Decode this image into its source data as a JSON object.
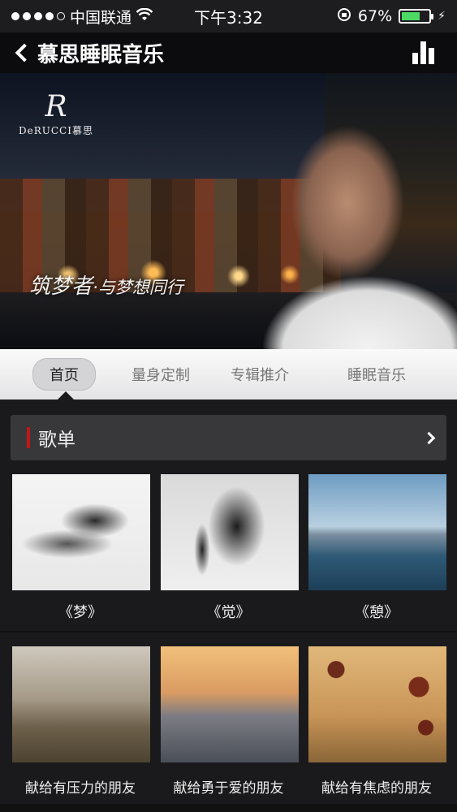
{
  "status_bar": {
    "carrier": "中国联通",
    "time": "下午3:32",
    "battery": "67%"
  },
  "nav": {
    "title": "慕思睡眠音乐"
  },
  "banner": {
    "brand_mark": "R",
    "brand_name": "DeRUCCI慕思",
    "slogan_main": "筑梦者",
    "slogan_tail": "·与梦想同行"
  },
  "tabs": [
    {
      "label": "首页",
      "active": true
    },
    {
      "label": "量身定制"
    },
    {
      "label": "专辑推介"
    },
    {
      "label": "睡眠音乐"
    }
  ],
  "section": {
    "title": "歌单"
  },
  "playlists": [
    {
      "title": "《梦》",
      "image": "smoke-image"
    },
    {
      "title": "《觉》",
      "image": "angel-image"
    },
    {
      "title": "《憩》",
      "image": "lake-image"
    },
    {
      "title": "献给有压力的朋友",
      "image": "hikers-image"
    },
    {
      "title": "献给勇于爱的朋友",
      "image": "couple-image"
    },
    {
      "title": "献给有焦虑的朋友",
      "image": "girl-image"
    }
  ]
}
